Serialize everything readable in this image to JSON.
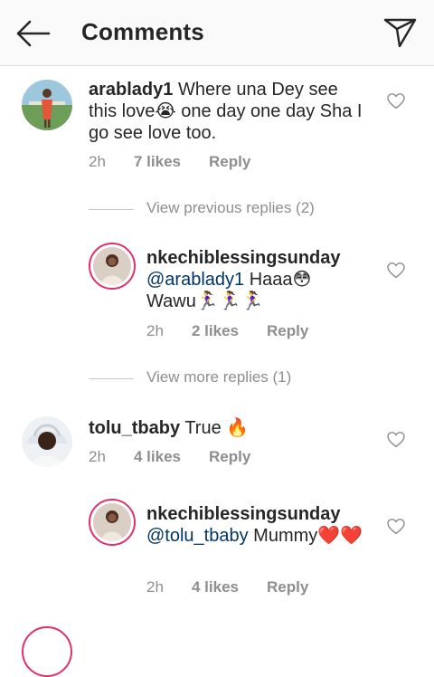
{
  "header": {
    "title": "Comments"
  },
  "comments": [
    {
      "username": "arablady1",
      "text": "Where una Dey see this love😭 one day one day Sha I go see love too.",
      "time": "2h",
      "likes": "7 likes",
      "reply_label": "Reply"
    },
    {
      "toggle": "View previous replies (2)"
    },
    {
      "username": "nkechiblessingsunday",
      "mention": "@arablady1",
      "text": " Haaa😳 Wawu🏃‍♀️🏃‍♀️🏃‍♀️",
      "time": "2h",
      "likes": "2 likes",
      "reply_label": "Reply"
    },
    {
      "toggle": "View more replies (1)"
    },
    {
      "username": "tolu_tbaby",
      "text": "True 🔥",
      "time": "2h",
      "likes": "4 likes",
      "reply_label": "Reply"
    },
    {
      "username": "nkechiblessingsunday",
      "mention": "@tolu_tbaby",
      "text": " Mummy❤️❤️",
      "time": "2h",
      "likes": "4 likes",
      "reply_label": "Reply"
    }
  ],
  "colors": {
    "accent_ring": "#e1306c",
    "mention": "#003569",
    "meta_gray": "#8e8e8e"
  },
  "icons": [
    "back-arrow-icon",
    "send-icon",
    "heart-outline-icon"
  ]
}
